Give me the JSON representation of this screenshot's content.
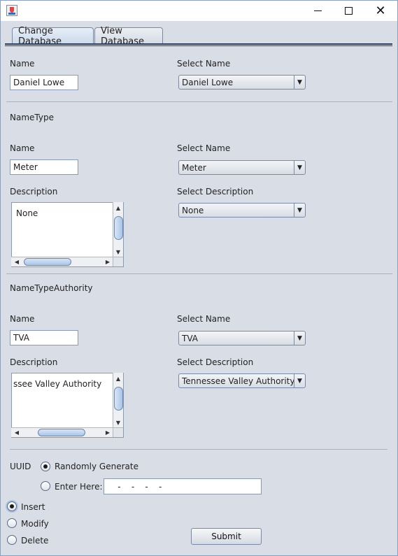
{
  "window": {
    "title": "",
    "controls": [
      "minimize-icon",
      "maximize-icon",
      "close-icon"
    ]
  },
  "tabs": [
    {
      "label": "Change Database",
      "selected": true
    },
    {
      "label": "View Database",
      "selected": false
    }
  ],
  "section1": {
    "name_label": "Name",
    "name_value": "Daniel Lowe",
    "select_name_label": "Select Name",
    "select_name_value": "Daniel Lowe"
  },
  "section2": {
    "heading": "NameType",
    "name_label": "Name",
    "name_value": "Meter",
    "select_name_label": "Select Name",
    "select_name_value": "Meter",
    "description_label": "Description",
    "description_text": "None",
    "select_description_label": "Select Description",
    "select_description_value": "None"
  },
  "section3": {
    "heading": "NameTypeAuthority",
    "name_label": "Name",
    "name_value": "TVA",
    "select_name_label": "Select Name",
    "select_name_value": "TVA",
    "description_label": "Description",
    "description_text": "ssee Valley Authority",
    "select_description_label": "Select Description",
    "select_description_value": "Tennessee Valley Authority"
  },
  "uuid": {
    "label": "UUID",
    "options": [
      {
        "label": "Randomly Generate",
        "checked": true
      },
      {
        "label": "Enter Here:",
        "checked": false
      }
    ],
    "field_value": "    -    -    -    -"
  },
  "actions": {
    "options": [
      {
        "label": "Insert",
        "checked": true
      },
      {
        "label": "Modify",
        "checked": false
      },
      {
        "label": "Delete",
        "checked": false
      }
    ],
    "submit_label": "Submit"
  }
}
